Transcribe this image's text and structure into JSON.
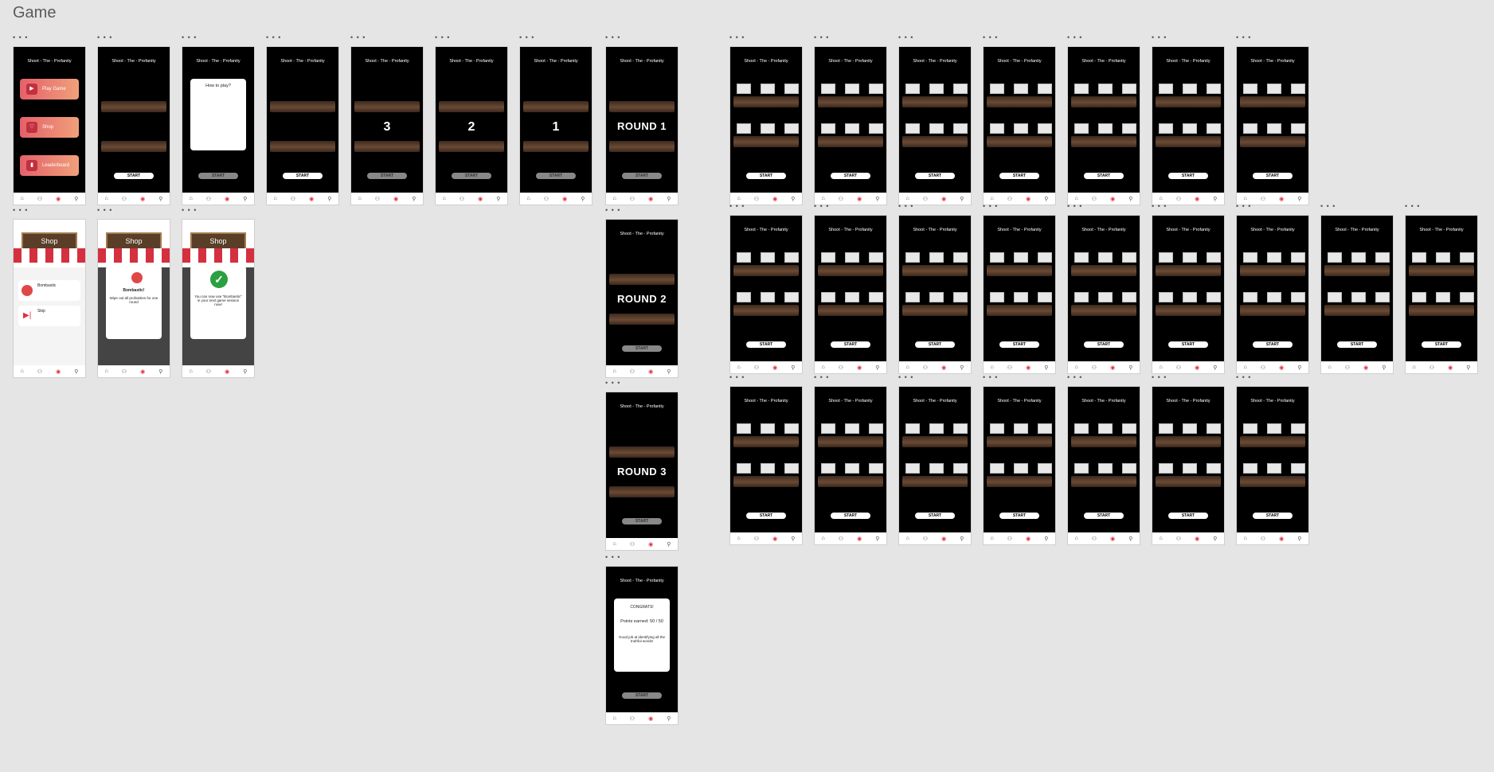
{
  "page": {
    "title": "Game",
    "app_title": "Shoot - The - Profanity",
    "start": "START",
    "count_3": "3",
    "count_2": "2",
    "count_1": "1",
    "round1": "ROUND 1",
    "round2": "ROUND 2",
    "round3": "ROUND 3",
    "menu_play": "Play Game",
    "menu_shop": "Shop",
    "menu_leader": "Leaderboard",
    "how_to_play": "How to play?",
    "shop": "Shop",
    "bombastic": "Bombastic!",
    "bombastic_desc": "Wipe out all profanities for one round",
    "bought_msg": "You can now use \"Bombastic\" in your next game session now!",
    "congrats": "CONGRATS!",
    "points_earned": "Points earned: 50 / 50",
    "good_job": "Good job at identifying all the truthful words!",
    "item_bombastic": "Bombastic",
    "item_skip": "Skip"
  }
}
